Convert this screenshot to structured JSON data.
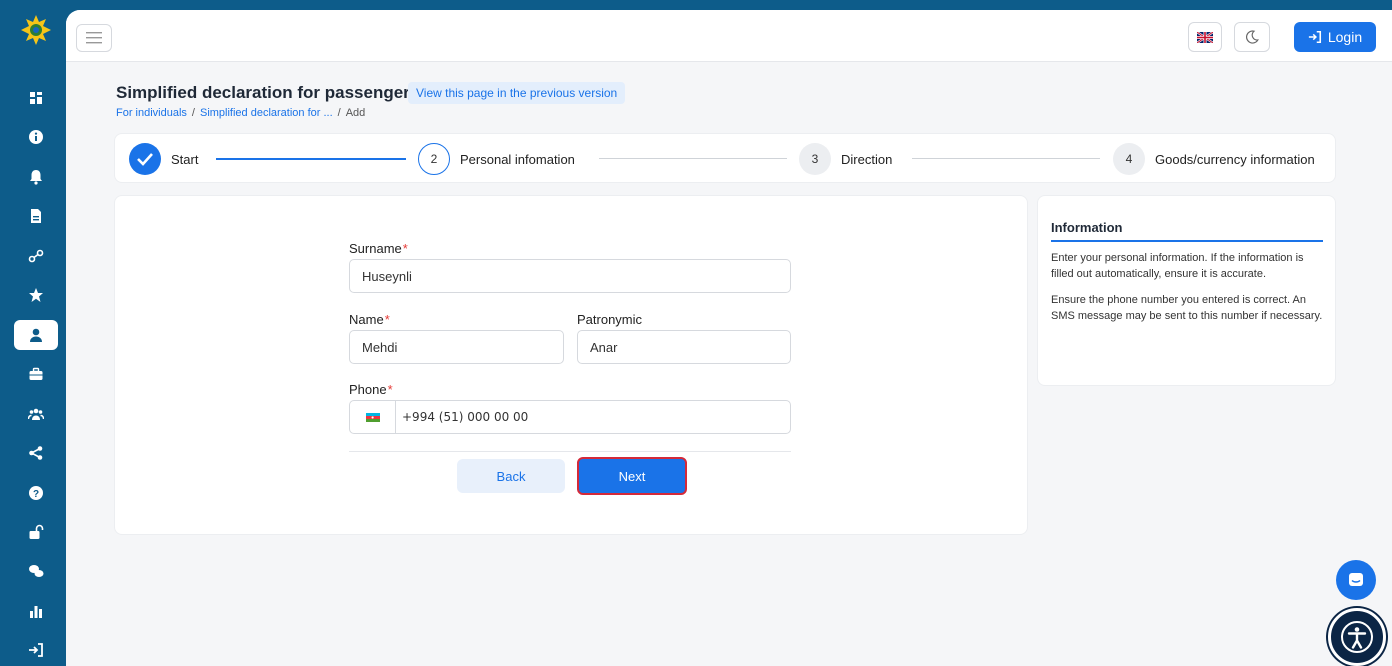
{
  "app": {
    "top_bar": {
      "login_label": "Login",
      "language_icon": "uk-flag-icon",
      "theme_icon": "moon-icon"
    },
    "sidebar": {
      "items": [
        {
          "icon": "dashboard-icon"
        },
        {
          "icon": "info-icon"
        },
        {
          "icon": "bell-icon"
        },
        {
          "icon": "document-icon"
        },
        {
          "icon": "network-icon"
        },
        {
          "icon": "star-icon"
        },
        {
          "icon": "user-icon",
          "active": true
        },
        {
          "icon": "briefcase-icon"
        },
        {
          "icon": "users-icon"
        },
        {
          "icon": "share-icon"
        },
        {
          "icon": "question-icon"
        },
        {
          "icon": "unlock-icon"
        },
        {
          "icon": "chat-icon"
        },
        {
          "icon": "bar-chart-icon"
        },
        {
          "icon": "sign-in-icon"
        }
      ]
    }
  },
  "page": {
    "title": "Simplified declaration for passengers",
    "prev_version_link": "View this page in the previous version",
    "breadcrumb": {
      "home": "For individuals",
      "sep1": "/",
      "parent": "Simplified declaration for ...",
      "sep2": "/",
      "current": "Add"
    }
  },
  "stepper": {
    "steps": [
      {
        "num": "",
        "label": "Start",
        "state": "done"
      },
      {
        "num": "2",
        "label": "Personal infomation",
        "state": "current"
      },
      {
        "num": "3",
        "label": "Direction",
        "state": "pending"
      },
      {
        "num": "4",
        "label": "Goods/currency information",
        "state": "pending"
      }
    ]
  },
  "form": {
    "surname": {
      "label": "Surname",
      "required_mark": "*",
      "value": "Huseynli"
    },
    "name": {
      "label": "Name",
      "required_mark": "*",
      "value": "Mehdi"
    },
    "patronymic": {
      "label": "Patronymic",
      "value": "Anar"
    },
    "phone": {
      "label": "Phone",
      "required_mark": "*",
      "value": "+994 (51) 000 00 00",
      "flag_icon": "azerbaijan-flag-icon"
    },
    "back_label": "Back",
    "next_label": "Next"
  },
  "info_panel": {
    "title": "Information",
    "paragraphs": [
      "Enter your personal information. If the information is filled out automatically, ensure it is accurate.",
      "Ensure the phone number you entered is correct. An SMS message may be sent to this number if necessary."
    ]
  },
  "floating": {
    "chat_icon": "chat-bubble-icon",
    "accessibility_icon": "accessibility-icon"
  },
  "colors": {
    "primary": "#1a73e8",
    "sidebar": "#0d5c8a",
    "required": "#e53935",
    "highlight_border": "#d42a3a"
  }
}
